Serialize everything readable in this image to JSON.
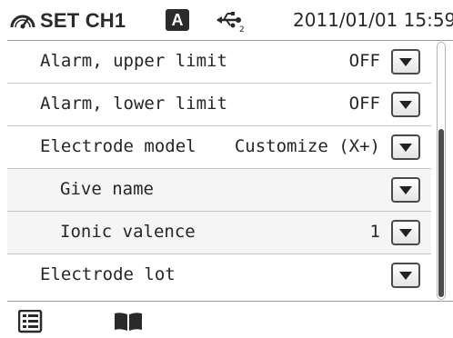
{
  "header": {
    "title": "SET CH1",
    "channel_badge": "A",
    "datetime": "2011/01/01 15:59",
    "gauge_icon": "gauge-icon",
    "usb_icon": "usb-icon"
  },
  "settings": {
    "rows": [
      {
        "label": "Alarm, upper limit",
        "value": "OFF"
      },
      {
        "label": "Alarm, lower limit",
        "value": "OFF"
      },
      {
        "label": "Electrode model",
        "value": "Customize (X+)"
      },
      {
        "label": "Give name",
        "value": ""
      },
      {
        "label": "Ionic valence",
        "value": "1"
      },
      {
        "label": "Electrode lot",
        "value": ""
      }
    ]
  },
  "scrollbar": {
    "visible_fraction": 0.66,
    "scroll_position": 0.34
  },
  "footer": {
    "menu_icon": "menu-list-icon",
    "book_icon": "book-icon"
  },
  "colors": {
    "text": "#262626",
    "divider": "#c6c6c6",
    "scroll_thumb": "#4d4d4d"
  }
}
